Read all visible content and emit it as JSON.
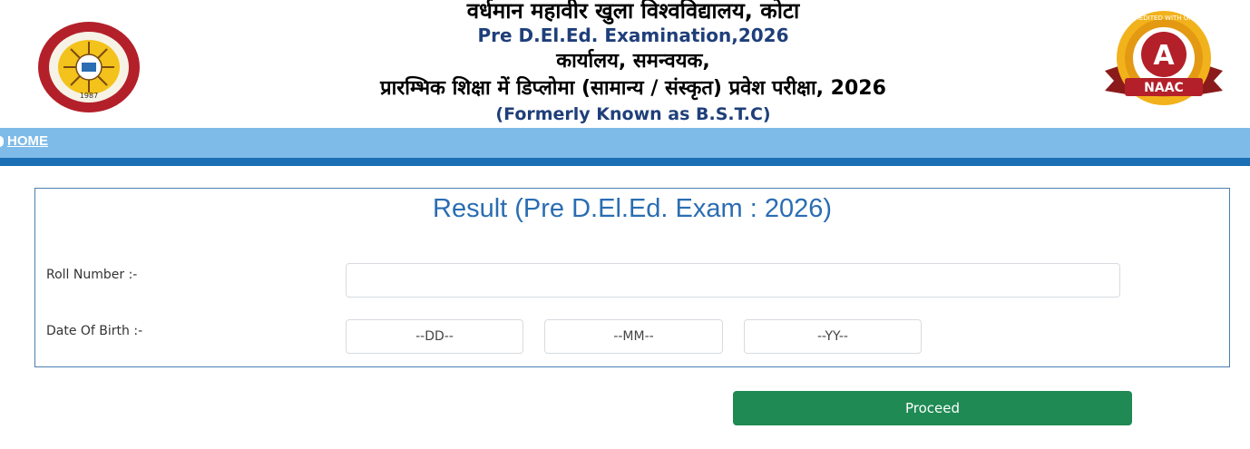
{
  "header": {
    "university_name": "वर्धमान महावीर खुला विश्वविद्यालय, कोटा",
    "exam_name": "Pre D.El.Ed. Examination,2026",
    "office": "कार्यालय, समन्वयक,",
    "program": "प्रारम्भिक शिक्षा में डिप्लोमा (सामान्य / संस्कृत) प्रवेश परीक्षा, 2026",
    "formerly": "(Formerly Known as B.S.T.C)",
    "logo_left_year": "1987",
    "badge_grade": "A",
    "badge_label": "NAAC",
    "badge_ring_text": "ACCREDITED WITH GRADE"
  },
  "nav": {
    "home_label": "HOME"
  },
  "form": {
    "title": "Result (Pre D.El.Ed. Exam : 2026)",
    "roll_label": "Roll Number :-",
    "roll_value": "",
    "dob_label": "Date Of Birth :-",
    "dd_selected": "--DD--",
    "mm_selected": "--MM--",
    "yy_selected": "--YY--",
    "proceed_label": "Proceed"
  },
  "colors": {
    "nav_bar": "#7fbbe8",
    "nav_strip": "#1b6fb5",
    "title_blue": "#2a6db2",
    "proceed_green": "#1f8a53"
  }
}
